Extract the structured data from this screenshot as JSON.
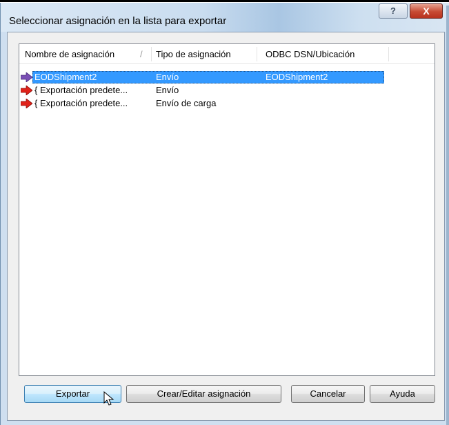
{
  "dialog": {
    "title": "Seleccionar asignación en la lista para exportar",
    "help_glyph": "?",
    "close_glyph": "X"
  },
  "list": {
    "columns": [
      "Nombre de asignación",
      "Tipo de asignación",
      "ODBC DSN/Ubicación"
    ],
    "sort_indicator": "/",
    "rows": [
      {
        "name": "EODShipment2",
        "type": "Envío",
        "location": "EODShipment2",
        "selected": true,
        "icon": "purple-arrow-icon"
      },
      {
        "name": "{ Exportación predete...",
        "type": "Envío",
        "location": "",
        "selected": false,
        "icon": "red-arrow-icon"
      },
      {
        "name": "{ Exportación predete...",
        "type": "Envío de carga",
        "location": "",
        "selected": false,
        "icon": "red-arrow-icon"
      }
    ]
  },
  "buttons": {
    "export": "Exportar",
    "create_edit": "Crear/Editar asignación",
    "cancel": "Cancelar",
    "help": "Ayuda"
  },
  "colors": {
    "selection": "#3399ff",
    "titlebar": "#c9dcef"
  }
}
